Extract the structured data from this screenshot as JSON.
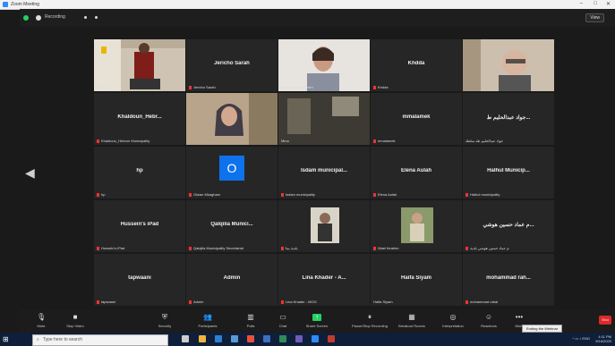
{
  "window": {
    "title": "Zoom Meeting",
    "controls": [
      "–",
      "□",
      "✕"
    ]
  },
  "topbar": {
    "recording_label": "Recording",
    "view_button": "View"
  },
  "tiles": [
    {
      "name": "",
      "label": "iPhone",
      "video": "person-stairs",
      "active": true
    },
    {
      "name": "Jericho Sarah",
      "label": "Jericho Sarah",
      "video": ""
    },
    {
      "name": "",
      "label": "Beit Sahour Women",
      "video": "woman-head"
    },
    {
      "name": "Khdda",
      "label": "Khdda",
      "video": ""
    },
    {
      "name": "",
      "label": "",
      "video": "man-glasses"
    },
    {
      "name": "Khaldoun_Hebr...",
      "label": "Khaldoun_Hebron Municipality",
      "video": ""
    },
    {
      "name": "",
      "label": "",
      "video": "woman-hijab"
    },
    {
      "name": "",
      "label": "Mina",
      "video": "room"
    },
    {
      "name": "mmalamek",
      "label": "mmalamek",
      "video": ""
    },
    {
      "name": "جواد عبدالحليم ط...",
      "label": "جواد عبدالحليم طه سلطة",
      "video": ""
    },
    {
      "name": "hp",
      "label": "hp",
      "video": ""
    },
    {
      "name": "",
      "label": "Olwan Mkagham",
      "video": "avatar-o"
    },
    {
      "name": "Isdam municipal...",
      "label": "Isdam municipality",
      "video": ""
    },
    {
      "name": "Elena Aulah",
      "label": "Elena Aulah",
      "video": ""
    },
    {
      "name": "Halhul Municip...",
      "label": "Halhul municipality",
      "video": ""
    },
    {
      "name": "Hussein's iPad",
      "label": "Hussein's iPad",
      "video": ""
    },
    {
      "name": "Qalqilia Munici...",
      "label": "Qalqilia Municipality Secretariat",
      "video": ""
    },
    {
      "name": "",
      "label": "بلدية بيتا",
      "video": "man-standing"
    },
    {
      "name": "",
      "label": "Wael Ibrahim",
      "video": "man-outdoor"
    },
    {
      "name": "م عماد حسين هوشي...",
      "label": "م عماد حسين هوشي بلدية",
      "video": ""
    },
    {
      "name": "tapwaani",
      "label": "tapwaani",
      "video": ""
    },
    {
      "name": "Admin",
      "label": "Admin",
      "video": ""
    },
    {
      "name": "Lina Khader - A...",
      "label": "Lina Khader - MOG",
      "video": ""
    },
    {
      "name": "Haifa Siyam",
      "label": "Haifa Siyam",
      "video": ""
    },
    {
      "name": "mohammad rah...",
      "label": "mohammad rahal",
      "video": ""
    }
  ],
  "toolbar": {
    "buttons": [
      {
        "label": "Mute",
        "icon": "mic-icon"
      },
      {
        "label": "Stop Video",
        "icon": "video-icon"
      },
      {
        "label": "Security",
        "icon": "shield-icon"
      },
      {
        "label": "Participants",
        "icon": "participants-icon"
      },
      {
        "label": "Polls",
        "icon": "polls-icon"
      },
      {
        "label": "Chat",
        "icon": "chat-icon"
      },
      {
        "label": "Share Screen",
        "icon": "share-screen-icon"
      },
      {
        "label": "Pause/Stop Recording",
        "icon": "record-icon"
      },
      {
        "label": "Breakout Rooms",
        "icon": "breakout-icon"
      },
      {
        "label": "Interpretation",
        "icon": "globe-icon"
      },
      {
        "label": "Reactions",
        "icon": "reactions-icon"
      },
      {
        "label": "More",
        "icon": "more-icon"
      }
    ],
    "end_label": "End",
    "tooltip": "Ending the Webinar"
  },
  "taskbar": {
    "search_placeholder": "Type here to search",
    "time": "4:11 PM",
    "date": "9/16/2020"
  },
  "colors": {
    "active_speaker": "#d6d618",
    "share_green": "#23d160",
    "end_red": "#e02828",
    "avatar_blue": "#0e72ed"
  }
}
